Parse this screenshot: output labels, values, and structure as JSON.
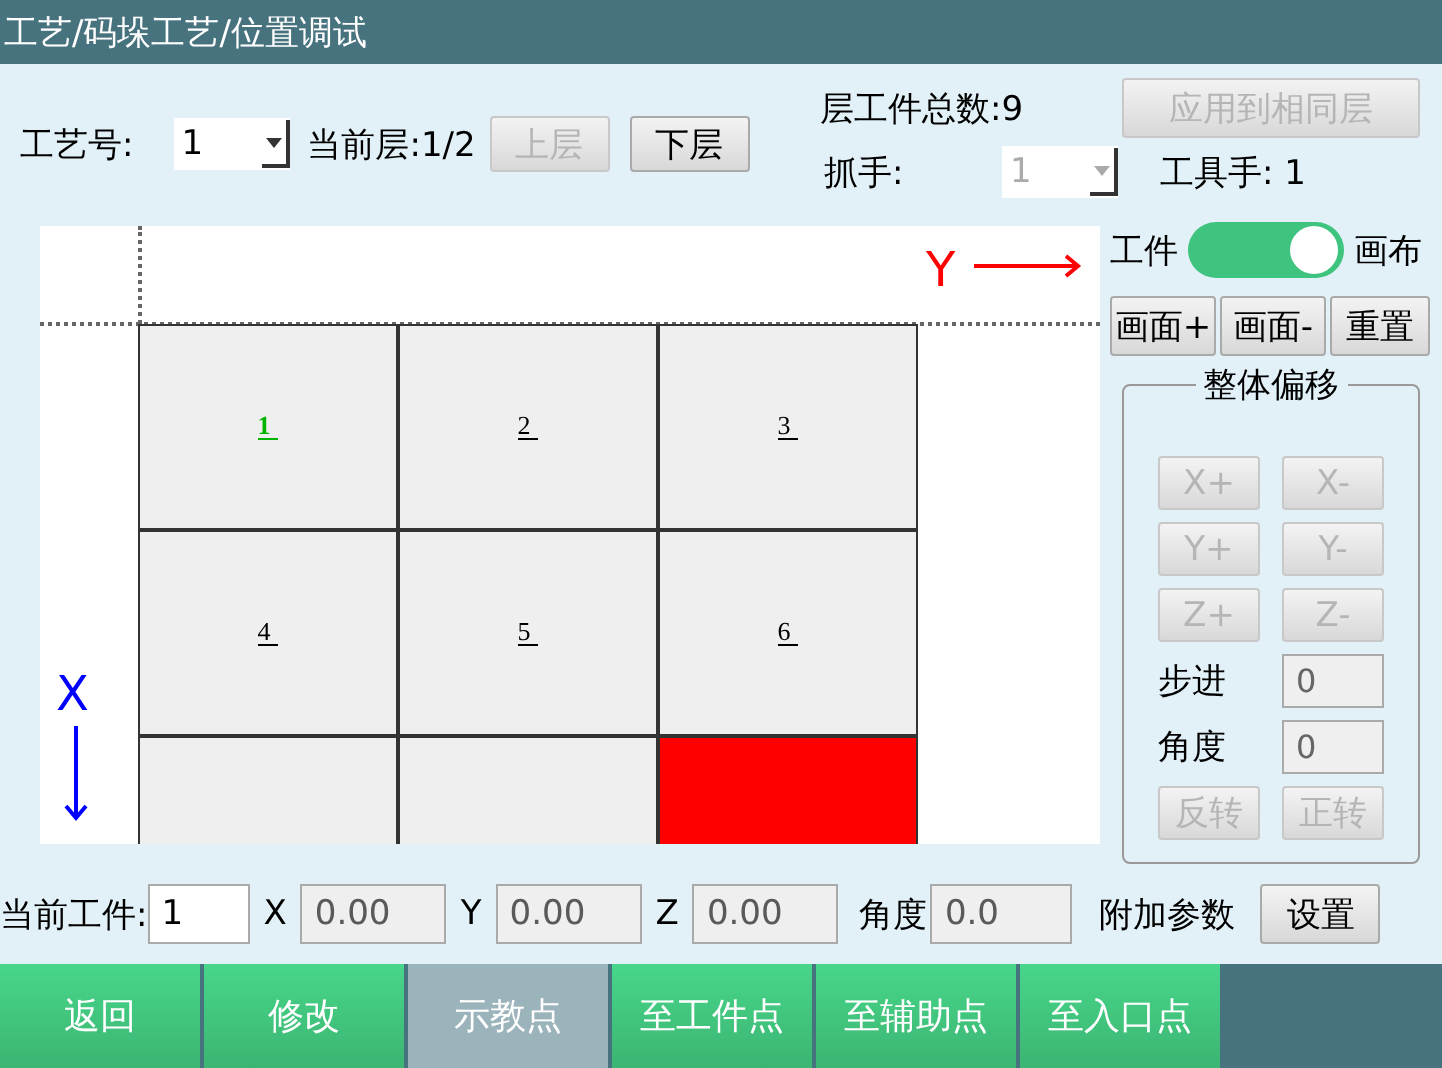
{
  "title": "工艺/码垛工艺/位置调试",
  "toolbar": {
    "process_label": "工艺号:",
    "process_select": {
      "value": "1",
      "disabled": false
    },
    "layer_text": "当前层:1/2",
    "layer_buttons": [
      {
        "label": "上层",
        "disabled": true
      },
      {
        "label": "下层",
        "disabled": false
      }
    ],
    "total_text": "层工件总数:9",
    "apply_button": {
      "label": "应用到相同层",
      "disabled": true
    },
    "gripper_label": "抓手:",
    "gripper_select": {
      "value": "1",
      "disabled": true
    },
    "tool_text": "工具手: 1"
  },
  "canvas": {
    "y_axis_label": "Y",
    "x_axis_label": "X",
    "cells": [
      {
        "label": "1",
        "selected": true,
        "color": "#efefef"
      },
      {
        "label": "2",
        "selected": false,
        "color": "#efefef"
      },
      {
        "label": "3",
        "selected": false,
        "color": "#efefef"
      },
      {
        "label": "4",
        "selected": false,
        "color": "#efefef"
      },
      {
        "label": "5",
        "selected": false,
        "color": "#efefef"
      },
      {
        "label": "6",
        "selected": false,
        "color": "#efefef"
      },
      {
        "color": "#efefef"
      },
      {
        "color": "#efefef"
      },
      {
        "color": "#ff0000"
      }
    ]
  },
  "view_toggle": {
    "left_label": "工件",
    "right_label": "画布",
    "on": true
  },
  "view_buttons": [
    {
      "label": "画面+",
      "disabled": false
    },
    {
      "label": "画面-",
      "disabled": false
    },
    {
      "label": "重置",
      "disabled": false
    }
  ],
  "offset_group": {
    "title": "整体偏移",
    "buttons": [
      {
        "label": "X+",
        "disabled": true
      },
      {
        "label": "X-",
        "disabled": true
      },
      {
        "label": "Y+",
        "disabled": true
      },
      {
        "label": "Y-",
        "disabled": true
      },
      {
        "label": "Z+",
        "disabled": true
      },
      {
        "label": "Z-",
        "disabled": true
      }
    ],
    "fields": [
      {
        "label": "步进",
        "value": "0"
      },
      {
        "label": "角度",
        "value": "0"
      }
    ],
    "rotate_buttons": [
      {
        "label": "反转",
        "disabled": true
      },
      {
        "label": "正转",
        "disabled": true
      }
    ]
  },
  "bottom": {
    "current_label": "当前工件:",
    "current_value": "1",
    "coords": [
      {
        "label": "X",
        "value": "0.00"
      },
      {
        "label": "Y",
        "value": "0.00"
      },
      {
        "label": "Z",
        "value": "0.00"
      },
      {
        "label": "角度",
        "value": "0.0"
      }
    ],
    "extra_label": "附加参数",
    "set_button": "设置"
  },
  "nav": [
    {
      "label": "返回",
      "selected": false
    },
    {
      "label": "修改",
      "selected": false
    },
    {
      "label": "示教点",
      "selected": true
    },
    {
      "label": "至工件点",
      "selected": false
    },
    {
      "label": "至辅助点",
      "selected": false
    },
    {
      "label": "至入口点",
      "selected": false
    }
  ]
}
